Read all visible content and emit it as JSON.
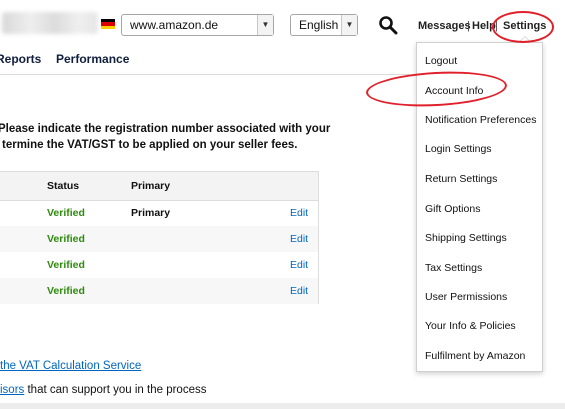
{
  "header": {
    "marketplace": "www.amazon.de",
    "language": "English",
    "links": {
      "messages": "Messages",
      "help": "Help",
      "settings": "Settings"
    },
    "separator": "|",
    "flag_colors": [
      "#000000",
      "#dd0000",
      "#ffce00"
    ]
  },
  "tabs": [
    "Reports",
    "Performance"
  ],
  "instructions": [
    "Please indicate the registration number associated with your",
    "termine the VAT/GST to be applied on your seller fees."
  ],
  "table": {
    "headers": {
      "status": "Status",
      "primary": "Primary"
    },
    "rows": [
      {
        "status": "Verified",
        "primary": "Primary",
        "action": "Edit"
      },
      {
        "status": "Verified",
        "primary": "",
        "action": "Edit"
      },
      {
        "status": "Verified",
        "primary": "",
        "action": "Edit"
      },
      {
        "status": "Verified",
        "primary": "",
        "action": "Edit"
      }
    ]
  },
  "footer": {
    "link_vat": "the VAT Calculation Service",
    "advisors_link": "isors",
    "advisors_text": " that can support you in the process"
  },
  "settings_menu": [
    "Logout",
    "Account Info",
    "Notification Preferences",
    "Login Settings",
    "Return Settings",
    "Gift Options",
    "Shipping Settings",
    "Tax Settings",
    "User Permissions",
    "Your Info & Policies",
    "Fulfilment by Amazon"
  ],
  "colors": {
    "annotation": "#e0202a",
    "verified": "#2e8b0e",
    "link": "#0066c0"
  }
}
